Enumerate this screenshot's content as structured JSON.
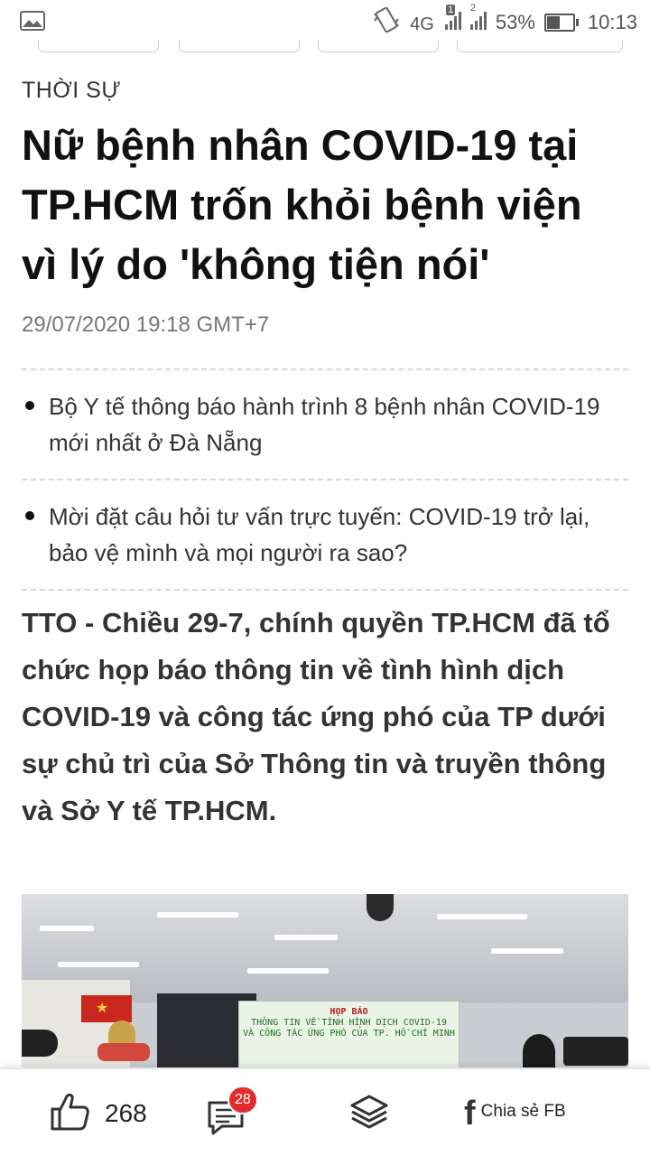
{
  "status_bar": {
    "network": "4G",
    "sim1": "1",
    "sim2": "2",
    "battery": "53%",
    "time": "10:13",
    "icons": [
      "image-icon",
      "vibrate-icon",
      "signal-icon",
      "battery-icon"
    ]
  },
  "article": {
    "category": "THỜI SỰ",
    "headline": "Nữ bệnh nhân COVID-19 tại TP.HCM trốn khỏi bệnh viện vì lý do 'không tiện nói'",
    "timestamp": "29/07/2020 19:18 GMT+7",
    "related": [
      {
        "text": "Bộ Y tế thông báo hành trình 8 bệnh nhân COVID-19 mới nhất ở Đà Nẵng"
      },
      {
        "text": "Mời đặt câu hỏi tư vấn trực tuyến: COVID-19 trở lại, bảo vệ mình và mọi người ra sao?"
      }
    ],
    "lead": "TTO - Chiều 29-7, chính quyền TP.HCM đã tổ chức họp báo thông tin về tình hình dịch COVID-19 và công tác ứng phó của TP dưới sự chủ trì của Sở Thông tin và truyền thông và Sở Y tế TP.HCM.",
    "photo_banner": {
      "heading": "HỌP BÁO",
      "line1": "THÔNG TIN VỀ TÌNH HÌNH DỊCH COVID-19",
      "line2": "VÀ CÔNG TÁC ỨNG PHÓ CỦA TP. HỒ CHÍ MINH"
    }
  },
  "bottom_bar": {
    "like_count": "268",
    "comment_badge": "28",
    "share_label": "Chia sẻ FB",
    "colors": {
      "badge": "#e32b2b"
    }
  }
}
